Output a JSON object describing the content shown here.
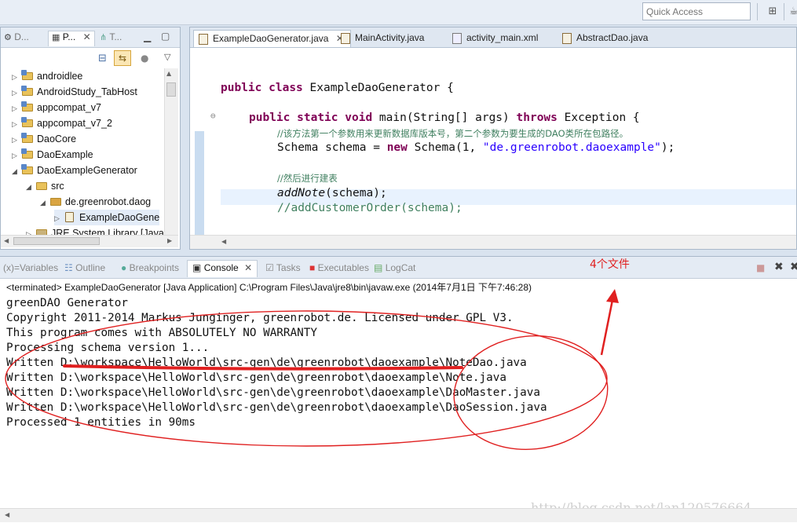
{
  "toolbar": {
    "quick_access_placeholder": "Quick Access"
  },
  "left_pane": {
    "tabs": [
      {
        "label": "D..."
      },
      {
        "label": "P..."
      },
      {
        "label": "T..."
      }
    ],
    "tree": [
      {
        "label": "androidlee",
        "level": 0,
        "expanded": false
      },
      {
        "label": "AndroidStudy_TabHost",
        "level": 0,
        "expanded": false
      },
      {
        "label": "appcompat_v7",
        "level": 0,
        "expanded": false
      },
      {
        "label": "appcompat_v7_2",
        "level": 0,
        "expanded": false
      },
      {
        "label": "DaoCore",
        "level": 0,
        "expanded": false
      },
      {
        "label": "DaoExample",
        "level": 0,
        "expanded": false
      },
      {
        "label": "DaoExampleGenerator",
        "level": 0,
        "expanded": true
      },
      {
        "label": "src",
        "level": 1,
        "expanded": true
      },
      {
        "label": "de.greenrobot.daog",
        "level": 2,
        "expanded": true
      },
      {
        "label": "ExampleDaoGene",
        "level": 3,
        "expanded": false
      },
      {
        "label": "JRE System Library [Java",
        "level": 1,
        "expanded": false
      }
    ]
  },
  "editor": {
    "tabs": [
      {
        "label": "ExampleDaoGenerator.java",
        "active": true
      },
      {
        "label": "MainActivity.java",
        "active": false
      },
      {
        "label": "activity_main.xml",
        "active": false
      },
      {
        "label": "AbstractDao.java",
        "active": false
      }
    ],
    "code": {
      "l1_kw1": "public",
      "l1_kw2": "class",
      "l1_rest": " ExampleDaoGenerator {",
      "l2_kw1": "public",
      "l2_kw2": "static",
      "l2_kw3": "void",
      "l2_mid": " main(String[] args) ",
      "l2_kw4": "throws",
      "l2_rest": " Exception {",
      "l3_comment": "//该方法第一个参数用来更新数据库版本号，第二个参数为要生成的DAO类所在包路径。",
      "l4_a": "Schema schema = ",
      "l4_kw": "new",
      "l4_b": " Schema(1, ",
      "l4_str": "\"de.greenrobot.daoexample\"",
      "l4_c": ");",
      "l5_comment": "//然后进行建表",
      "l6_a": "addNote",
      "l6_b": "(schema);",
      "l7_comment": "//addCustomerOrder(schema);"
    }
  },
  "bottom": {
    "tabs": [
      {
        "label": "Variables",
        "active": false
      },
      {
        "label": "Outline",
        "active": false
      },
      {
        "label": "Breakpoints",
        "active": false
      },
      {
        "label": "Console",
        "active": true
      },
      {
        "label": "Tasks",
        "active": false
      },
      {
        "label": "Executables",
        "active": false
      },
      {
        "label": "LogCat",
        "active": false
      }
    ],
    "terminated_line": "<terminated> ExampleDaoGenerator [Java Application] C:\\Program Files\\Java\\jre8\\bin\\javaw.exe (2014年7月1日 下午7:46:28)",
    "console_lines": [
      "greenDAO Generator",
      "Copyright 2011-2014 Markus Junginger, greenrobot.de. Licensed under GPL V3.",
      "This program comes with ABSOLUTELY NO WARRANTY",
      "Processing schema version 1...",
      "Written D:\\workspace\\HelloWorld\\src-gen\\de\\greenrobot\\daoexample\\NoteDao.java",
      "Written D:\\workspace\\HelloWorld\\src-gen\\de\\greenrobot\\daoexample\\Note.java",
      "Written D:\\workspace\\HelloWorld\\src-gen\\de\\greenrobot\\daoexample\\DaoMaster.java",
      "Written D:\\workspace\\HelloWorld\\src-gen\\de\\greenrobot\\daoexample\\DaoSession.java",
      "Processed 1 entities in 90ms"
    ],
    "watermark": "http://blog.csdn.net/lan120576664"
  },
  "annotation": {
    "text": "4个文件",
    "color": "#e02020"
  },
  "colors": {
    "keyword": "#7f0055",
    "string": "#2a00ff",
    "comment": "#3f7f5f"
  }
}
